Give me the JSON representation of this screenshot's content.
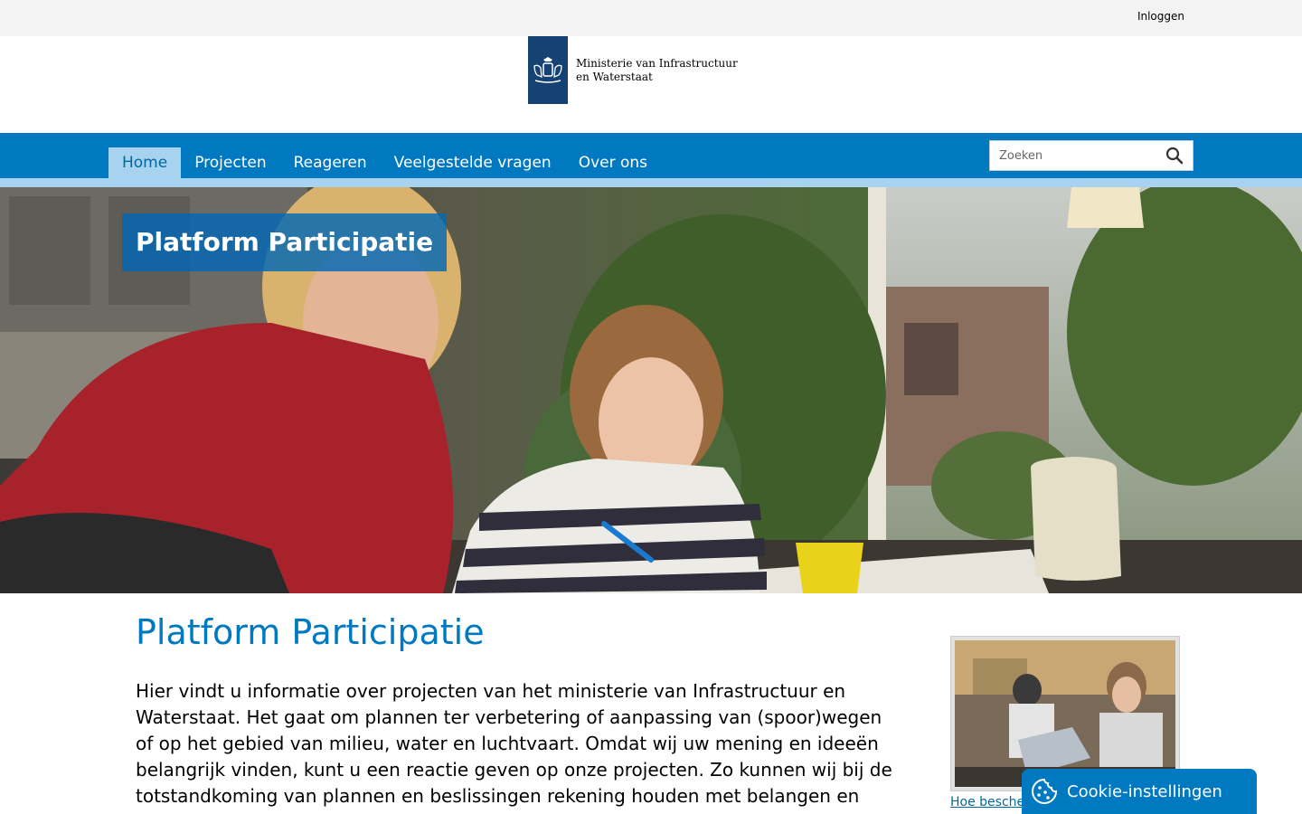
{
  "topbar": {
    "login_label": "Inloggen"
  },
  "logo": {
    "line1": "Ministerie van Infrastructuur",
    "line2": "en Waterstaat"
  },
  "nav": {
    "items": [
      {
        "label": "Home",
        "active": true
      },
      {
        "label": "Projecten",
        "active": false
      },
      {
        "label": "Reageren",
        "active": false
      },
      {
        "label": "Veelgestelde vragen",
        "active": false
      },
      {
        "label": "Over ons",
        "active": false
      }
    ],
    "search": {
      "placeholder": "Zoeken",
      "value": ""
    }
  },
  "hero": {
    "title": "Platform Participatie"
  },
  "main": {
    "title": "Platform Participatie",
    "intro": "Hier vindt u informatie over projecten van het ministerie van Infrastructuur en Waterstaat. Het gaat om plannen ter verbetering of aanpassing van (spoor)wegen of op het gebied van milieu, water en luchtvaart. Omdat wij uw mening en ideeën belangrijk vinden, kunt u een reactie geven op onze projecten. Zo kunnen wij bij de totstandkoming van plannen en beslissingen rekening houden met belangen en"
  },
  "sidebar": {
    "link_label": "Hoe bescher"
  },
  "cookie": {
    "label": "Cookie-instellingen"
  },
  "colors": {
    "brand_blue": "#0079c1",
    "nav_strip": "#a7d3f0",
    "logo_blue": "#154273"
  }
}
